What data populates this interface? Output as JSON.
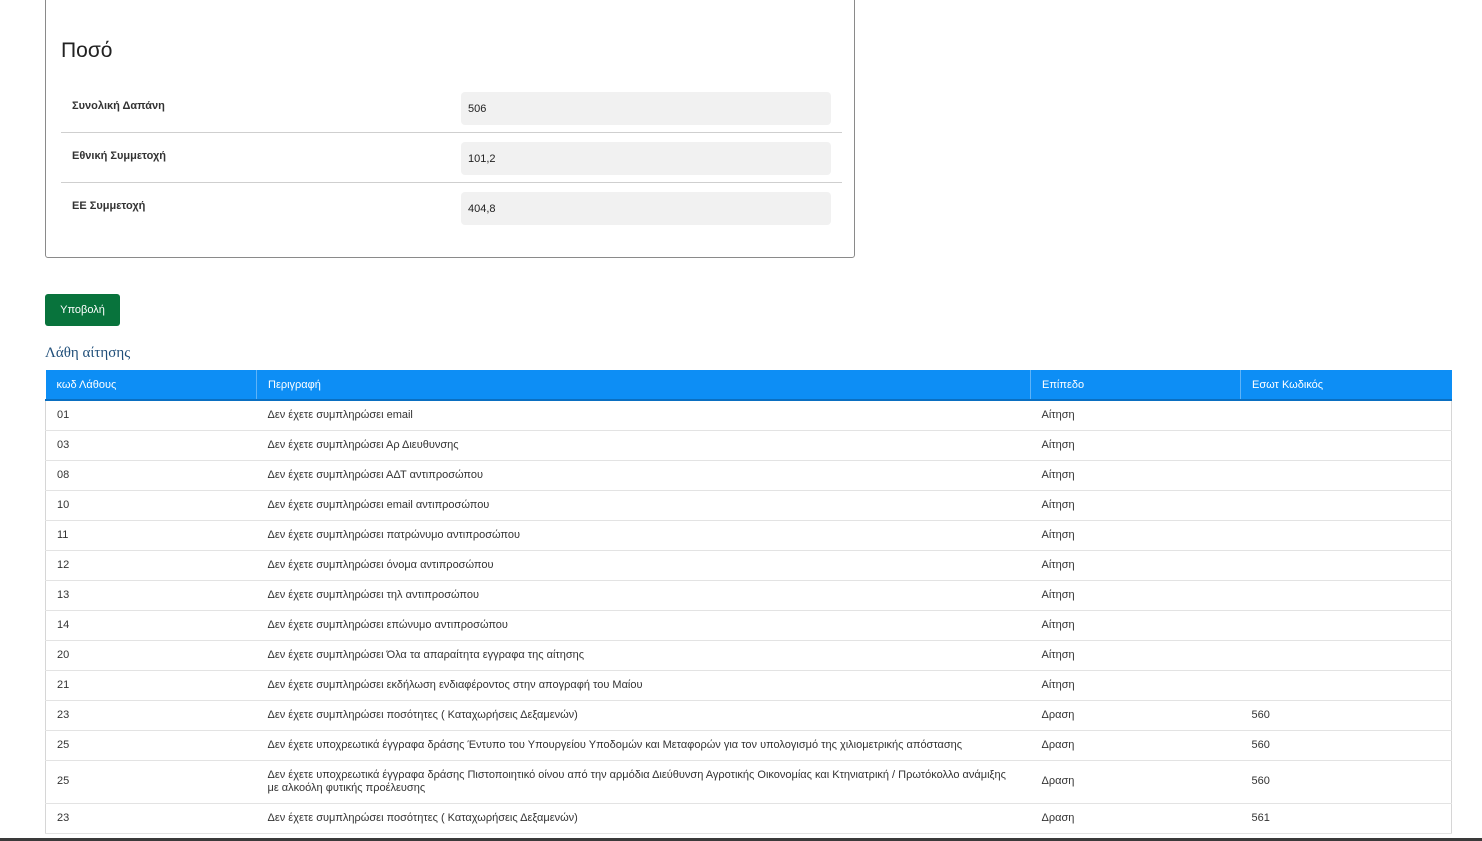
{
  "amount": {
    "title": "Ποσό",
    "rows": [
      {
        "label": "Συνολική Δαπάνη",
        "value": "506"
      },
      {
        "label": "Εθνική Συμμετοχή",
        "value": "101,2"
      },
      {
        "label": "ΕΕ Συμμετοχή",
        "value": "404,8"
      }
    ]
  },
  "submit_label": "Υποβολή",
  "errors": {
    "title": "Λάθη αίτησης",
    "headers": [
      "κωδ Λάθους",
      "Περιγραφή",
      "Επίπεδο",
      "Εσωτ Κωδικός"
    ],
    "rows": [
      {
        "code": "01",
        "description": "Δεν έχετε συμπληρώσει email",
        "level": "Αίτηση",
        "internal_code": ""
      },
      {
        "code": "03",
        "description": "Δεν έχετε συμπληρώσει Αρ Διευθυνσης",
        "level": "Αίτηση",
        "internal_code": ""
      },
      {
        "code": "08",
        "description": "Δεν έχετε συμπληρώσει ΑΔΤ αντιπροσώπου",
        "level": "Αίτηση",
        "internal_code": ""
      },
      {
        "code": "10",
        "description": "Δεν έχετε συμπληρώσει email αντιπροσώπου",
        "level": "Αίτηση",
        "internal_code": ""
      },
      {
        "code": "11",
        "description": "Δεν έχετε συμπληρώσει πατρώνυμο αντιπροσώπου",
        "level": "Αίτηση",
        "internal_code": ""
      },
      {
        "code": "12",
        "description": "Δεν έχετε συμπληρώσει όνομα αντιπροσώπου",
        "level": "Αίτηση",
        "internal_code": ""
      },
      {
        "code": "13",
        "description": "Δεν έχετε συμπληρώσει τηλ αντιπροσώπου",
        "level": "Αίτηση",
        "internal_code": ""
      },
      {
        "code": "14",
        "description": "Δεν έχετε συμπληρώσει επώνυμο αντιπροσώπου",
        "level": "Αίτηση",
        "internal_code": ""
      },
      {
        "code": "20",
        "description": "Δεν έχετε συμπληρώσει Όλα τα απαραίτητα εγγραφα της αίτησης",
        "level": "Αίτηση",
        "internal_code": ""
      },
      {
        "code": "21",
        "description": "Δεν έχετε συμπληρώσει εκδήλωση ενδιαφέροντος στην απογραφή του Μαίου",
        "level": "Αίτηση",
        "internal_code": ""
      },
      {
        "code": "23",
        "description": "Δεν έχετε συμπληρώσει ποσότητες ( Καταχωρήσεις Δεξαμενών)",
        "level": "Δραση",
        "internal_code": "560"
      },
      {
        "code": "25",
        "description": "Δεν έχετε υποχρεωτικά έγγραφα δράσης Έντυπο του Υπουργείου Υποδομών και Μεταφορών για τον υπολογισμό της χιλιομετρικής απόστασης",
        "level": "Δραση",
        "internal_code": "560"
      },
      {
        "code": "25",
        "description": "Δεν έχετε υποχρεωτικά έγγραφα δράσης Πιστοποιητικό οίνου από την αρμόδια Διεύθυνση Αγροτικής Οικονομίας και Κτηνιατρική / Πρωτόκολλο ανάμιξης με αλκοόλη φυτικής προέλευσης",
        "level": "Δραση",
        "internal_code": "560"
      },
      {
        "code": "23",
        "description": "Δεν έχετε συμπληρώσει ποσότητες ( Καταχωρήσεις Δεξαμενών)",
        "level": "Δραση",
        "internal_code": "561"
      }
    ]
  },
  "colors": {
    "submit_button": "#08733c",
    "table_header": "#0d8ef5",
    "errors_title": "#1f4e79"
  }
}
